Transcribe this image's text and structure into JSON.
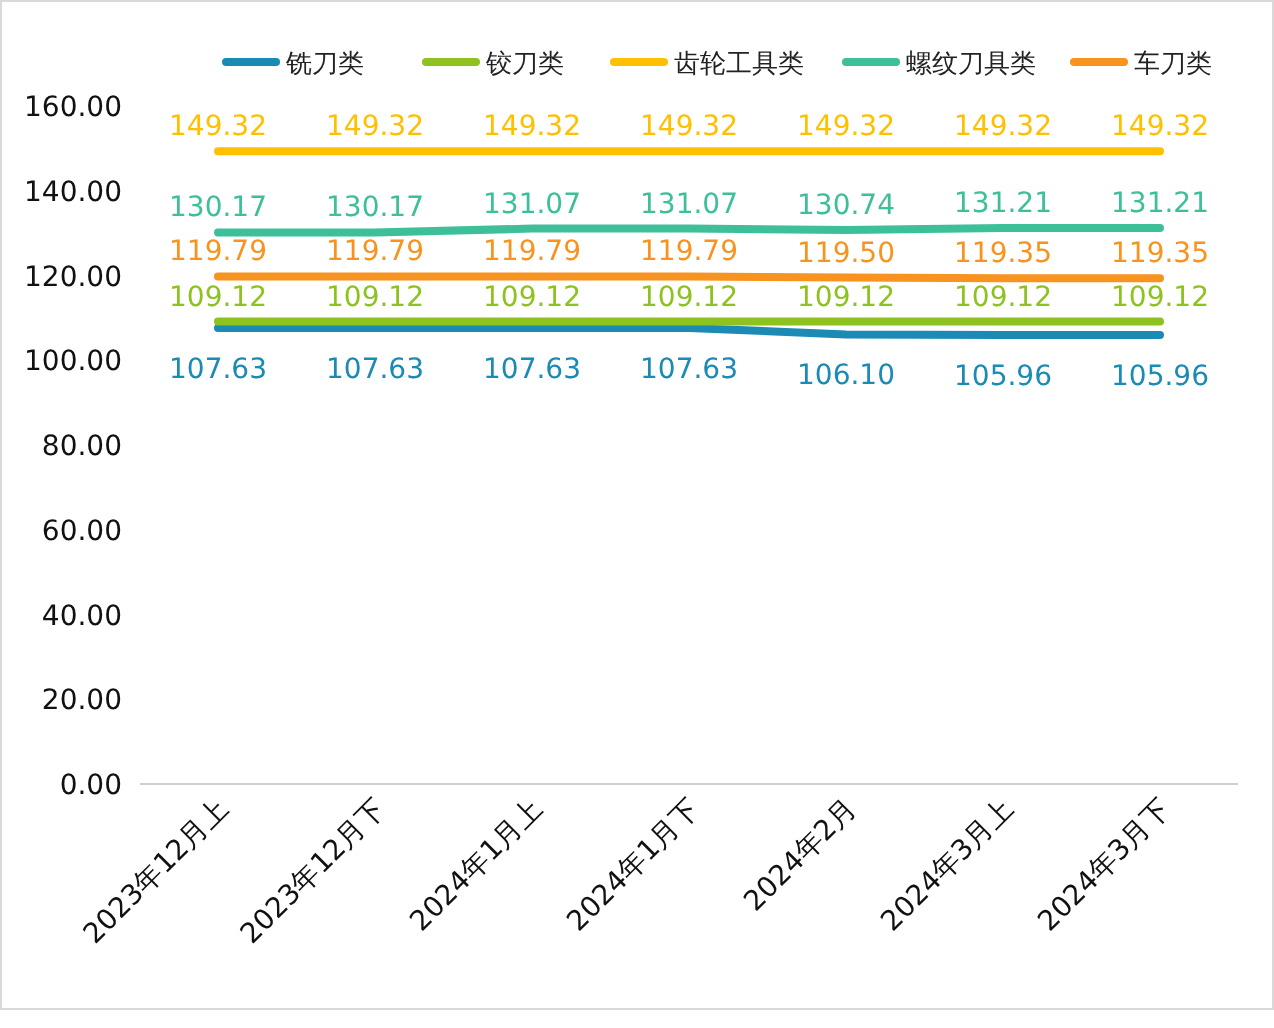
{
  "chart_data": {
    "type": "line",
    "categories": [
      "2023年12月上",
      "2023年12月下",
      "2024年1月上",
      "2024年1月下",
      "2024年2月",
      "2024年3月上",
      "2024年3月下"
    ],
    "series": [
      {
        "name": "铣刀类",
        "color": "#1b8ab5",
        "values": [
          107.63,
          107.63,
          107.63,
          107.63,
          106.1,
          105.96,
          105.96
        ],
        "value_labels": [
          "107.63",
          "107.63",
          "107.63",
          "107.63",
          "106.10",
          "105.96",
          "105.96"
        ]
      },
      {
        "name": "铰刀类",
        "color": "#8dc21f",
        "values": [
          109.12,
          109.12,
          109.12,
          109.12,
          109.12,
          109.12,
          109.12
        ],
        "value_labels": [
          "109.12",
          "109.12",
          "109.12",
          "109.12",
          "109.12",
          "109.12",
          "109.12"
        ]
      },
      {
        "name": "齿轮工具类",
        "color": "#ffc000",
        "values": [
          149.32,
          149.32,
          149.32,
          149.32,
          149.32,
          149.32,
          149.32
        ],
        "value_labels": [
          "149.32",
          "149.32",
          "149.32",
          "149.32",
          "149.32",
          "149.32",
          "149.32"
        ]
      },
      {
        "name": "螺纹刀具类",
        "color": "#3dbf9a",
        "values": [
          130.17,
          130.17,
          131.07,
          131.07,
          130.74,
          131.21,
          131.21
        ],
        "value_labels": [
          "130.17",
          "130.17",
          "131.07",
          "131.07",
          "130.74",
          "131.21",
          "131.21"
        ]
      },
      {
        "name": "车刀类",
        "color": "#f7931e",
        "values": [
          119.79,
          119.79,
          119.79,
          119.79,
          119.5,
          119.35,
          119.35
        ],
        "value_labels": [
          "119.79",
          "119.79",
          "119.79",
          "119.79",
          "119.50",
          "119.35",
          "119.35"
        ]
      }
    ],
    "legend": true,
    "ylim": [
      0,
      160
    ],
    "yticks": [
      {
        "value": 0,
        "label": "0.00"
      },
      {
        "value": 20,
        "label": "20.00"
      },
      {
        "value": 40,
        "label": "40.00"
      },
      {
        "value": 60,
        "label": "60.00"
      },
      {
        "value": 80,
        "label": "80.00"
      },
      {
        "value": 100,
        "label": "100.00"
      },
      {
        "value": 120,
        "label": "120.00"
      },
      {
        "value": 140,
        "label": "140.00"
      },
      {
        "value": 160,
        "label": "160.00"
      }
    ],
    "data_labels": true
  }
}
